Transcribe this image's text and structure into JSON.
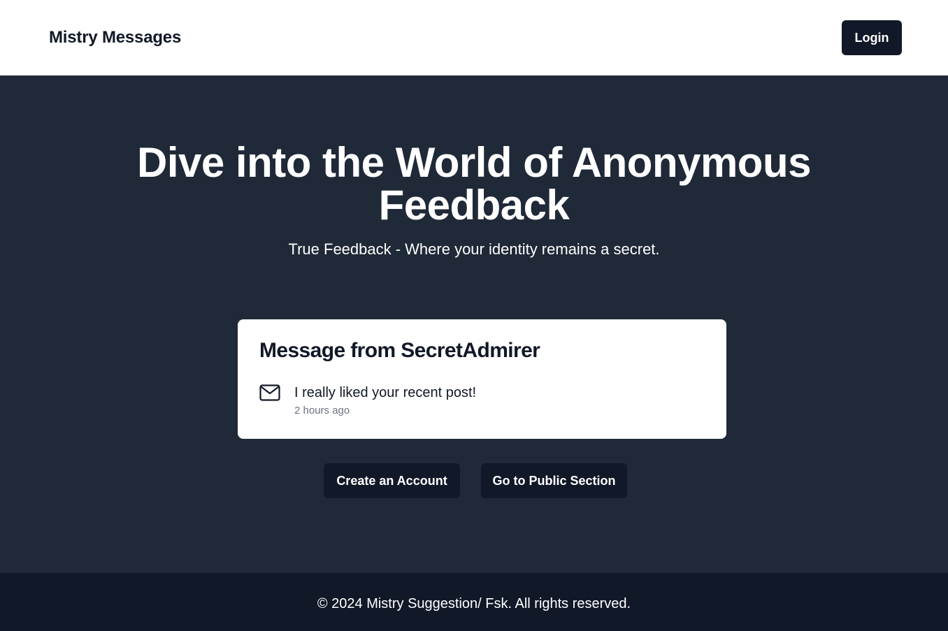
{
  "navbar": {
    "brand": "Mistry Messages",
    "login_label": "Login"
  },
  "hero": {
    "headline_line1": "Dive into the World of Anonymous",
    "headline_line2": "Feedback",
    "subheadline": "True Feedback - Where your identity remains a secret."
  },
  "message_card": {
    "title": "Message from SecretAdmirer",
    "icon": "mail-icon",
    "message": "I really liked your recent post!",
    "time": "2 hours ago"
  },
  "actions": {
    "create_account_label": "Create an Account",
    "public_section_label": "Go to Public Section"
  },
  "footer": {
    "text": "© 2024 Mistry Suggestion/ Fsk. All rights reserved."
  },
  "colors": {
    "hero_bg": "#1f2937",
    "footer_bg": "#111827",
    "button_bg": "#111827",
    "card_bg": "#ffffff",
    "muted_text": "#6b7280"
  }
}
